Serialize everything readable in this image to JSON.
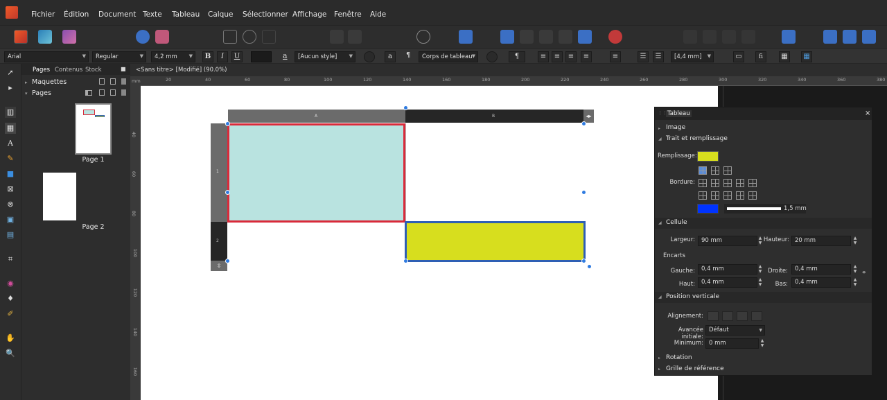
{
  "menubar": {
    "items": [
      "Fichier",
      "Édition",
      "Document",
      "Texte",
      "Tableau",
      "Calque",
      "Sélectionner",
      "Affichage",
      "Fenêtre",
      "Aide"
    ]
  },
  "context_toolbar": {
    "font": "Arial",
    "weight": "Regular",
    "size": "4,2 mm",
    "bold": "B",
    "italic": "I",
    "underline": "U",
    "char_style_glyph": "a",
    "char_style": "[Aucun style]",
    "para_glyph": "a",
    "pilcrow": "¶",
    "para_style": "Corps de tableau",
    "spacing": "[4,4 mm]",
    "fi": "fi"
  },
  "studio": {
    "tabs": [
      "Pages",
      "Contenus",
      "Stock"
    ],
    "sections": [
      "Maquettes",
      "Pages"
    ],
    "pages": [
      "Page 1",
      "Page 2"
    ]
  },
  "document": {
    "title": "<Sans titre> [Modifié] (90.0%)"
  },
  "ruler": {
    "unit": "mm",
    "h_ticks": [
      "20",
      "40",
      "60",
      "80",
      "100",
      "120",
      "140",
      "160",
      "180",
      "200",
      "220",
      "240",
      "260",
      "280",
      "300",
      "320",
      "340",
      "360",
      "380"
    ],
    "v_ticks": [
      "40",
      "60",
      "80",
      "100",
      "120",
      "140",
      "160"
    ]
  },
  "table": {
    "col_headers": [
      "A",
      "B"
    ],
    "row_headers": [
      "1",
      "2"
    ],
    "colors": {
      "cell_a1_fill": "#b9e3e0",
      "cell_a1_border": "#d92a3a",
      "cell_b2_fill": "#d7de1e",
      "cell_b2_border": "#2e5fb4",
      "selection": "#3a78c8"
    }
  },
  "panel": {
    "title": "Tableau",
    "close": "×",
    "sections": {
      "image": "Image",
      "stroke_fill": "Trait et remplissage",
      "cell": "Cellule",
      "encarts": "Encarts",
      "vertical_position": "Position verticale",
      "rotation": "Rotation",
      "reference_grid": "Grille de référence"
    },
    "fill_label": "Remplissage:",
    "fill_color": "#d7de1e",
    "border_label": "Bordure:",
    "border_color": "#0033ff",
    "border_width": "1,5 mm",
    "width_label": "Largeur:",
    "width_value": "90 mm",
    "height_label": "Hauteur:",
    "height_value": "20 mm",
    "left_label": "Gauche:",
    "left_value": "0,4 mm",
    "right_label": "Droite:",
    "right_value": "0,4 mm",
    "top_label": "Haut:",
    "top_value": "0,4 mm",
    "bottom_label": "Bas:",
    "bottom_value": "0,4 mm",
    "alignment_label": "Alignement:",
    "initial_advance_label": "Avancée initiale:",
    "initial_advance_value": "Défaut",
    "minimum_label": "Minimum:",
    "minimum_value": "0 mm"
  }
}
